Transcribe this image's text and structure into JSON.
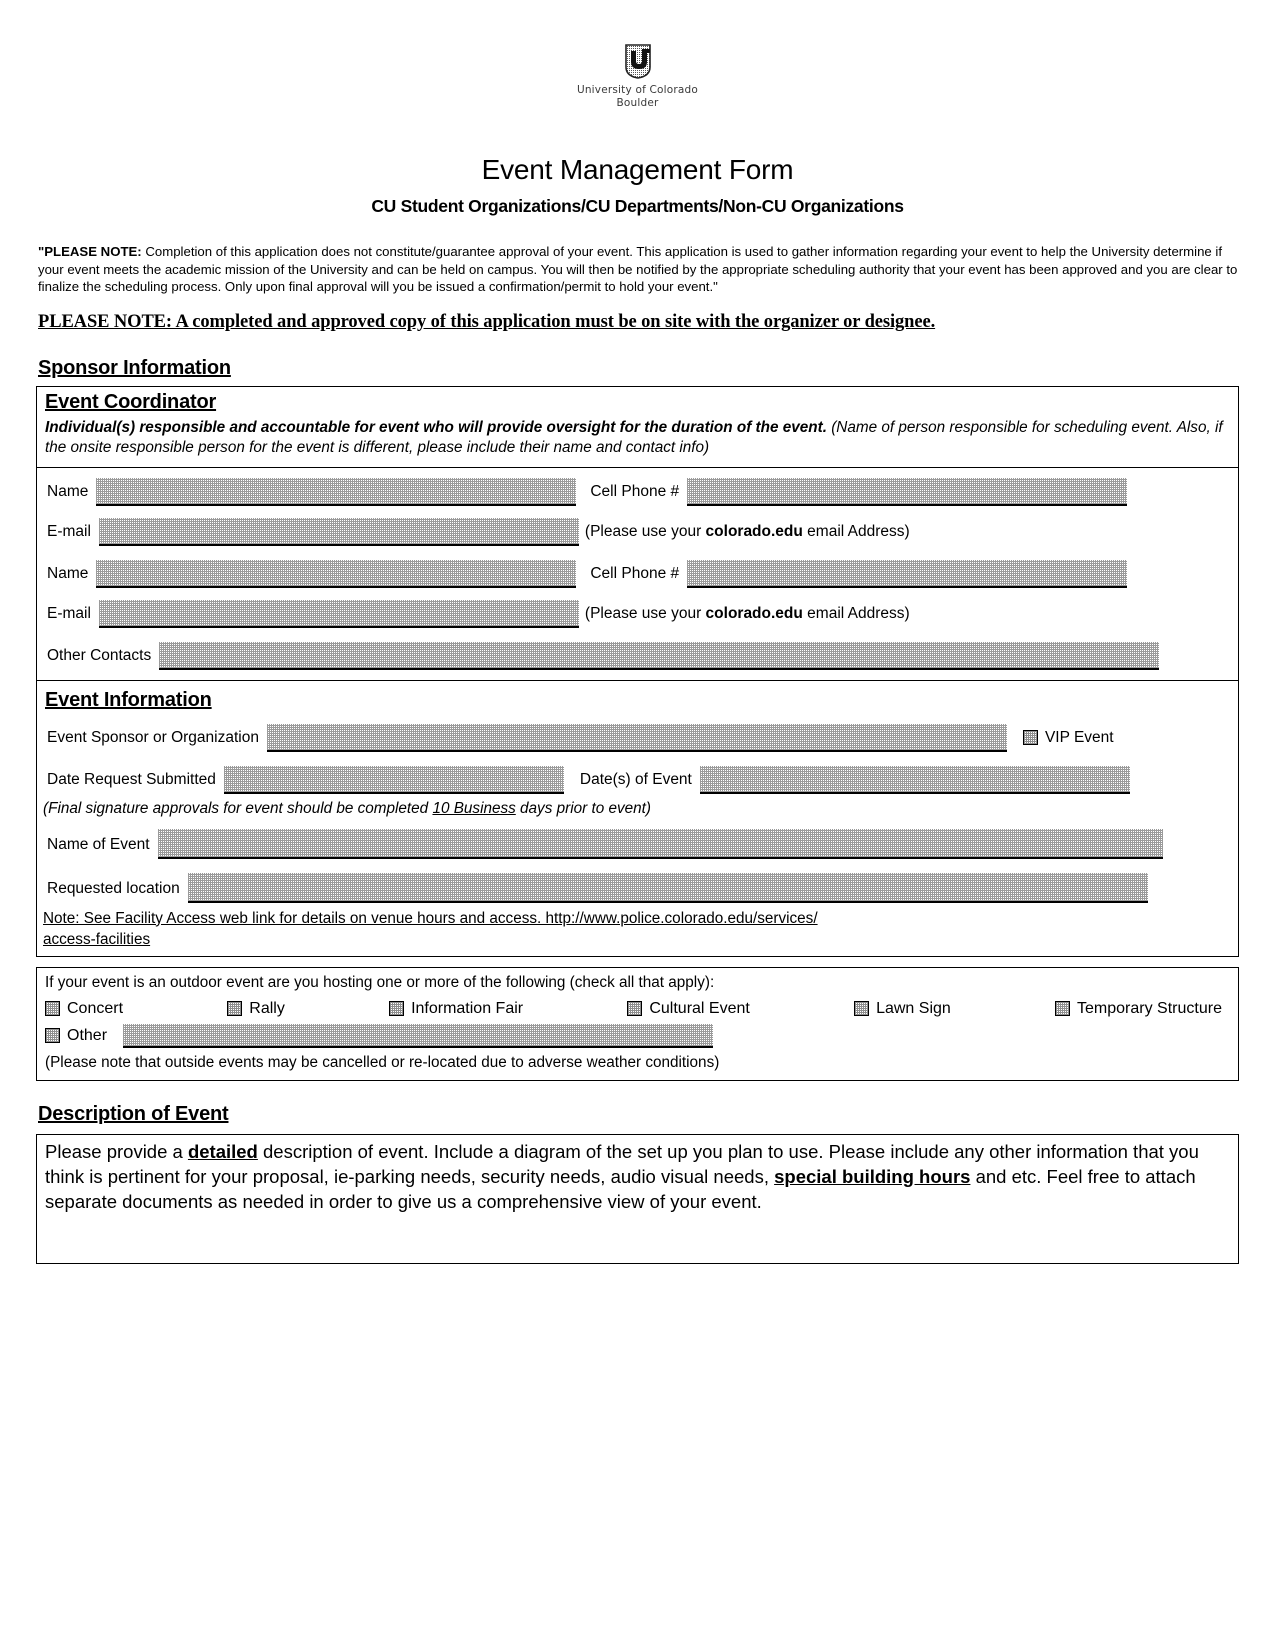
{
  "logo": {
    "icon": "cu-boulder-logo",
    "wordmark_line1": "University of Colorado",
    "wordmark_line2": "Boulder"
  },
  "header": {
    "title": "Event Management Form",
    "subtitle": "CU Student Organizations/CU Departments/Non-CU Organizations"
  },
  "intro": {
    "label": "\"PLEASE NOTE:",
    "body": "  Completion of this application does not constitute/guarantee approval of your event.  This application is used to gather information regarding your event to help the University determine if your event meets the academic mission of the University and can be held on campus.  You will then be notified by the appropriate scheduling authority that your event has been approved and you are clear to finalize the scheduling process.  Only upon final approval will you be issued a confirmation/permit to hold your event.\"",
    "please_note_2": "PLEASE NOTE:  A completed and approved copy of this application must be on site with the organizer or designee."
  },
  "sponsor": {
    "heading": "Sponsor Information",
    "coordinator": {
      "heading": "Event Coordinator",
      "desc_bold": "Individual(s) responsible and accountable for event who will provide oversight for the duration of the event.",
      "desc_rest": " (Name of person responsible for scheduling event.  Also, if the onsite responsible person for the event is different, please include their name and contact info)",
      "fields": {
        "name_label": "Name",
        "cell_label": "Cell Phone #",
        "email_label": "E-mail",
        "email_note_pre": "(Please use your ",
        "email_note_bold": "colorado.edu",
        "email_note_post": "  email Address)",
        "name2_label": "Name",
        "cell2_label": "Cell Phone #",
        "email2_label": "E-mail",
        "other_contacts_label": "Other Contacts",
        "name_value": "",
        "cell_value": "",
        "email_value": "",
        "name2_value": "",
        "cell2_value": "",
        "email2_value": "",
        "other_contacts_value": ""
      }
    }
  },
  "event_info": {
    "heading": "Event Information",
    "sponsor_org_label": "Event Sponsor or Organization",
    "sponsor_org_value": "",
    "vip_label": "VIP Event",
    "vip_checked": false,
    "date_submitted_label": "Date Request Submitted",
    "date_submitted_value": "",
    "dates_of_event_label": "Date(s) of Event",
    "dates_of_event_value": "",
    "signature_note_pre": "(Final signature approvals for event should be completed ",
    "signature_note_underline": "10 Business",
    "signature_note_post": " days prior to event)",
    "name_of_event_label": "Name of Event",
    "name_of_event_value": "",
    "requested_location_label": "Requested location",
    "requested_location_value": "",
    "facility_note_line1": "Note:  See Facility Access web link for details on venue hours and access.  http://www.police.colorado.edu/services/",
    "facility_note_line2": "access-facilities"
  },
  "outdoor": {
    "question": "If your event is an outdoor event are you hosting one or more of the following (check all that apply):",
    "options": [
      {
        "label": "Concert",
        "checked": false
      },
      {
        "label": "Rally",
        "checked": false
      },
      {
        "label": "Information Fair",
        "checked": false
      },
      {
        "label": "Cultural Event",
        "checked": false
      },
      {
        "label": "Lawn Sign",
        "checked": false
      },
      {
        "label": "Temporary Structure",
        "checked": false
      }
    ],
    "other_label": "Other",
    "other_checked": false,
    "other_value": "",
    "weather_note": "(Please note that outside events may be cancelled or re-located due to adverse weather conditions)"
  },
  "description": {
    "heading": "Description of Event",
    "p1": "Please provide a ",
    "b1": "detailed",
    "p2": " description of event.  Include a diagram of the set up you plan to use.  Please include any other information that you think is pertinent for your proposal, ie-parking needs, security needs, audio visual needs, ",
    "b2": "special building hours",
    "p3": " and etc.  Feel free to attach separate documents as needed in order to give us a comprehensive view of your event.",
    "body_value": ""
  }
}
